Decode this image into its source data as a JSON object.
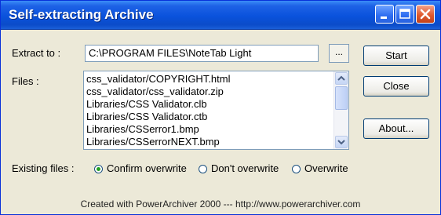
{
  "window": {
    "title": "Self-extracting Archive"
  },
  "extract": {
    "label": "Extract to :",
    "path": "C:\\PROGRAM FILES\\NoteTab Light",
    "browse_label": "..."
  },
  "files": {
    "label": "Files :",
    "items": [
      "css_validator/COPYRIGHT.html",
      "css_validator/css_validator.zip",
      "Libraries/CSS Validator.clb",
      "Libraries/CSS Validator.ctb",
      "Libraries/CSSerror1.bmp",
      "Libraries/CSSerrorNEXT.bmp"
    ]
  },
  "buttons": {
    "start": "Start",
    "close": "Close",
    "about": "About..."
  },
  "existing": {
    "label": "Existing files :",
    "options": [
      "Confirm overwrite",
      "Don't overwrite",
      "Overwrite"
    ],
    "selected": "Confirm overwrite"
  },
  "footer": {
    "text": "Created with PowerArchiver 2000 --- http://www.powerarchiver.com"
  }
}
